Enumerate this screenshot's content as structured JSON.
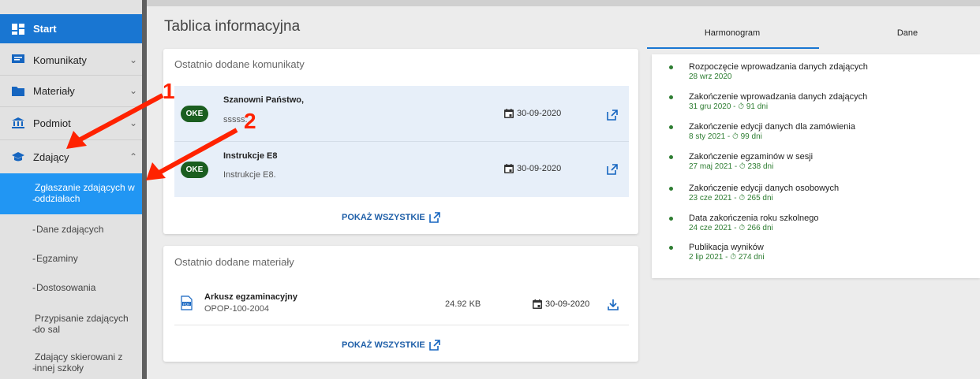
{
  "sidebar": {
    "start": "Start",
    "komunikaty": "Komunikaty",
    "materialy": "Materiały",
    "podmiot": "Podmiot",
    "zdajacy": "Zdający",
    "sub_active": "Zgłaszanie zdających w oddziałach",
    "sub": [
      "Dane zdających",
      "Egzaminy",
      "Dostosowania",
      "Przypisanie zdających do sal",
      "Zdający skierowani z innej szkoły"
    ],
    "dash": "-"
  },
  "main": {
    "title": "Tablica informacyjna",
    "messages": {
      "title": "Ostatnio dodane komunikaty",
      "items": [
        {
          "badge": "OKE",
          "title": "Szanowni Państwo,",
          "sub": "sssss.",
          "date": "30-09-2020"
        },
        {
          "badge": "OKE",
          "title": "Instrukcje E8",
          "sub": "Instrukcje E8.",
          "date": "30-09-2020"
        }
      ],
      "show_all": "POKAŻ WSZYSTKIE"
    },
    "materials": {
      "title": "Ostatnio dodane materiały",
      "items": [
        {
          "file_icon": "pdf-icon",
          "file_label": "PDF",
          "title": "Arkusz egzaminacyjny",
          "sub": "OPOP-100-2004",
          "size": "24.92 KB",
          "date": "30-09-2020"
        }
      ],
      "show_all": "POKAŻ WSZYSTKIE"
    }
  },
  "right": {
    "tabs": [
      "Harmonogram",
      "Dane"
    ],
    "events": [
      {
        "title": "Rozpoczęcie wprowadzania danych zdających",
        "date": "28 wrz 2020"
      },
      {
        "title": "Zakończenie wprowadzania danych zdających",
        "date": "31 gru 2020 - ⏱ 91 dni"
      },
      {
        "title": "Zakończenie edycji danych dla zamówienia",
        "date": "8 sty 2021 - ⏱ 99 dni"
      },
      {
        "title": "Zakończenie egzaminów w sesji",
        "date": "27 maj 2021 - ⏱ 238 dni"
      },
      {
        "title": "Zakończenie edycji danych osobowych",
        "date": "23 cze 2021 - ⏱ 265 dni"
      },
      {
        "title": "Data zakończenia roku szkolnego",
        "date": "24 cze 2021 - ⏱ 266 dni"
      },
      {
        "title": "Publikacja wyników",
        "date": "2 lip 2021 - ⏱ 274 dni"
      }
    ]
  },
  "annotations": {
    "one": "1",
    "two": "2"
  },
  "colors": {
    "accent": "#1976d2",
    "oke": "#1b5e20",
    "event_green": "#2e7d32",
    "annotation": "#ff2200"
  }
}
